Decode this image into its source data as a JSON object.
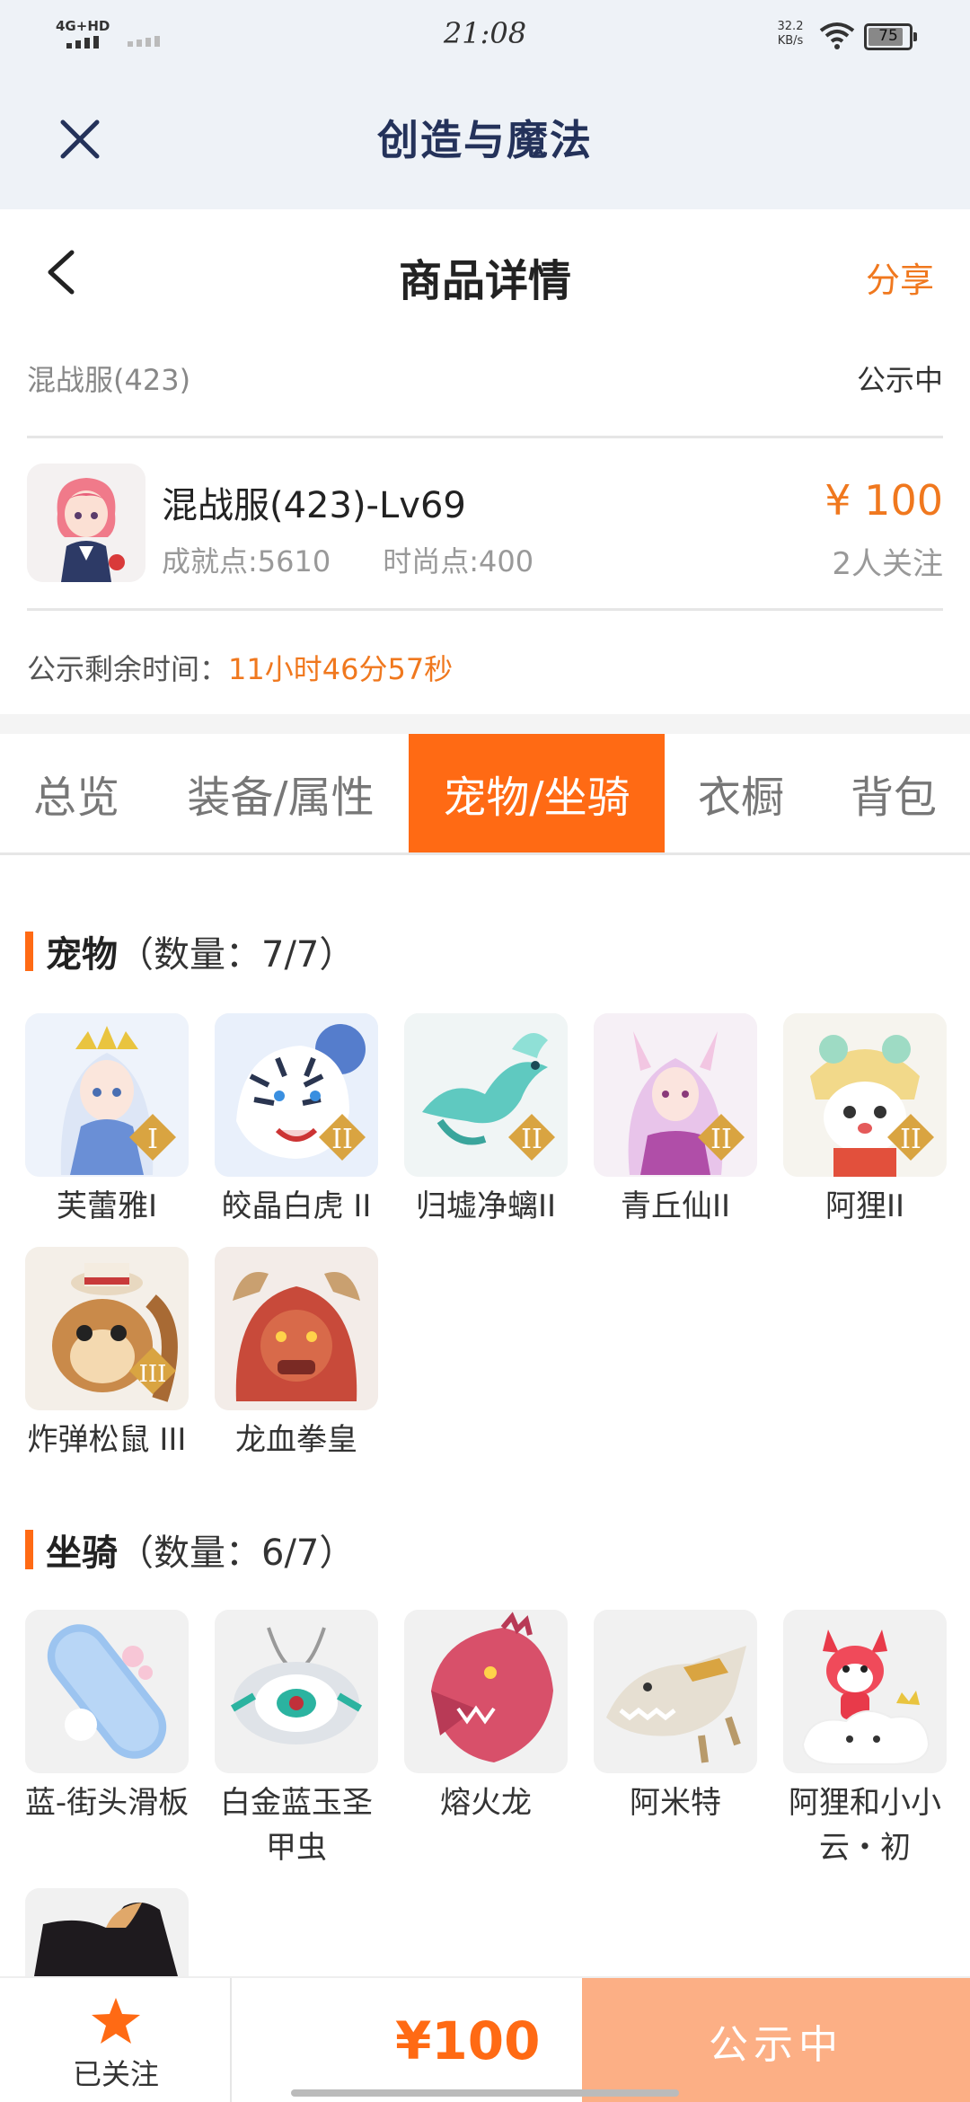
{
  "status_bar": {
    "network": "4G+HD",
    "time": "21:08",
    "speed_value": "32.2",
    "speed_unit": "KB/s",
    "battery": "75"
  },
  "app": {
    "title": "创造与魔法"
  },
  "header": {
    "title": "商品详情",
    "share_label": "分享"
  },
  "server": {
    "name": "混战服(423)",
    "status": "公示中"
  },
  "character": {
    "name": "混战服(423)-Lv69",
    "achievement": "成就点:5610",
    "fashion": "时尚点:400",
    "price": "¥ 100",
    "followers": "2人关注"
  },
  "remaining": {
    "label": "公示剩余时间：",
    "value": "11小时46分57秒"
  },
  "tabs": [
    {
      "label": "总览"
    },
    {
      "label": "装备/属性"
    },
    {
      "label": "宠物/坐骑"
    },
    {
      "label": "衣橱"
    },
    {
      "label": "背包"
    }
  ],
  "pets": {
    "title": "宠物",
    "count": "（数量：7/7）",
    "items": [
      {
        "label": "芙蕾雅I",
        "badge": "I"
      },
      {
        "label": "皎晶白虎 II",
        "badge": "II"
      },
      {
        "label": "归墟净螭II",
        "badge": "II"
      },
      {
        "label": "青丘仙II",
        "badge": "II"
      },
      {
        "label": "阿狸II",
        "badge": "II"
      },
      {
        "label": "炸弹松鼠 III",
        "badge": "III"
      },
      {
        "label": "龙血拳皇",
        "badge": ""
      }
    ]
  },
  "mounts": {
    "title": "坐骑",
    "count": "（数量：6/7）",
    "items": [
      {
        "label": "蓝-街头滑板"
      },
      {
        "label": "白金蓝玉圣甲虫"
      },
      {
        "label": "熔火龙"
      },
      {
        "label": "阿米特"
      },
      {
        "label": "阿狸和小小云・初"
      }
    ]
  },
  "bottom": {
    "follow_label": "已关注",
    "price": "¥100",
    "action_label": "公示中"
  },
  "colors": {
    "accent": "#ff6a14",
    "price": "#f0781e",
    "badge": "#d9a441"
  }
}
